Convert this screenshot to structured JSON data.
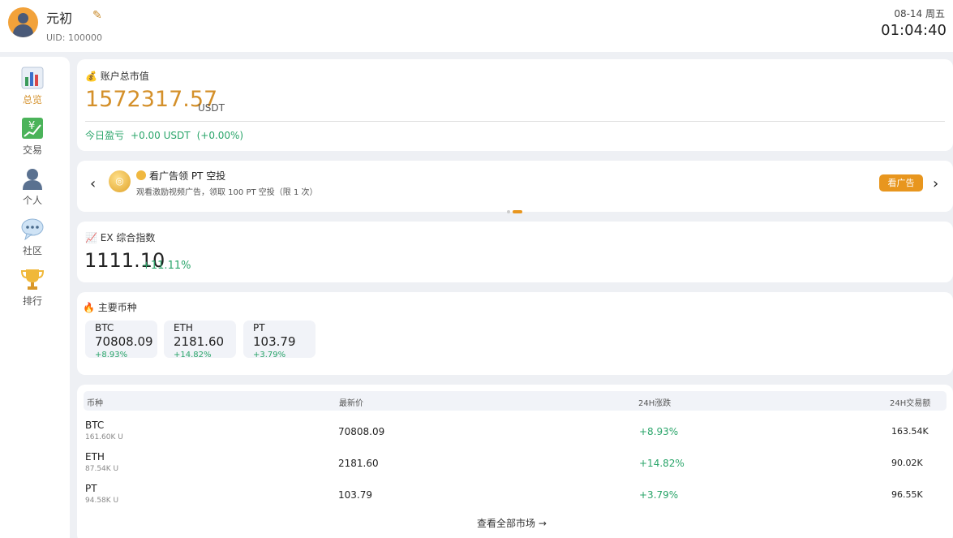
{
  "header": {
    "username": "元初",
    "uid": "UID: 100000",
    "date": "08-14 周五",
    "time": "01:04:40",
    "edit_icon": "pencil-icon"
  },
  "sidebar": {
    "items": [
      {
        "label": "总览",
        "icon": "bar-chart-icon",
        "active": true
      },
      {
        "label": "交易",
        "icon": "yen-chart-icon",
        "active": false
      },
      {
        "label": "个人",
        "icon": "user-icon",
        "active": false
      },
      {
        "label": "社区",
        "icon": "chat-bubble-icon",
        "active": false
      },
      {
        "label": "排行",
        "icon": "trophy-icon",
        "active": false
      }
    ]
  },
  "account": {
    "title": "账户总市值",
    "icon": "money-bag-icon",
    "total": "1572317.57",
    "unit": "USDT",
    "today_label": "今日盈亏",
    "today_value": "+0.00 USDT",
    "today_pct": "(+0.00%)"
  },
  "ad_banner": {
    "title": "看广告领 PT 空投",
    "description": "观看激励视频广告，领取 100 PT 空投（限 1 次）",
    "button_label": "看广告",
    "prev_arrow": "‹",
    "next_arrow": "›",
    "active_dot": 1,
    "dot_count": 2
  },
  "index": {
    "title": "EX 综合指数",
    "icon": "trend-chart-icon",
    "value": "1111.10",
    "change": "+11.11%"
  },
  "main_coins": {
    "title": "主要币种",
    "icon": "fire-icon",
    "coins": [
      {
        "symbol": "BTC",
        "price": "70808.09",
        "change": "+8.93%"
      },
      {
        "symbol": "ETH",
        "price": "2181.60",
        "change": "+14.82%"
      },
      {
        "symbol": "PT",
        "price": "103.79",
        "change": "+3.79%"
      }
    ]
  },
  "market": {
    "headers": [
      "币种",
      "最新价",
      "24H涨跌",
      "24H交易额"
    ],
    "rows": [
      {
        "symbol": "BTC",
        "volume": "161.60K U",
        "price": "70808.09",
        "change": "+8.93%",
        "turnover": "163.54K"
      },
      {
        "symbol": "ETH",
        "volume": "87.54K U",
        "price": "2181.60",
        "change": "+14.82%",
        "turnover": "90.02K"
      },
      {
        "symbol": "PT",
        "volume": "94.58K U",
        "price": "103.79",
        "change": "+3.79%",
        "turnover": "96.55K"
      }
    ],
    "view_all": "查看全部市场 →"
  },
  "colors": {
    "accent": "#d4902a",
    "up": "#2aa56a",
    "button": "#e8961e",
    "background": "#eef0f4"
  }
}
